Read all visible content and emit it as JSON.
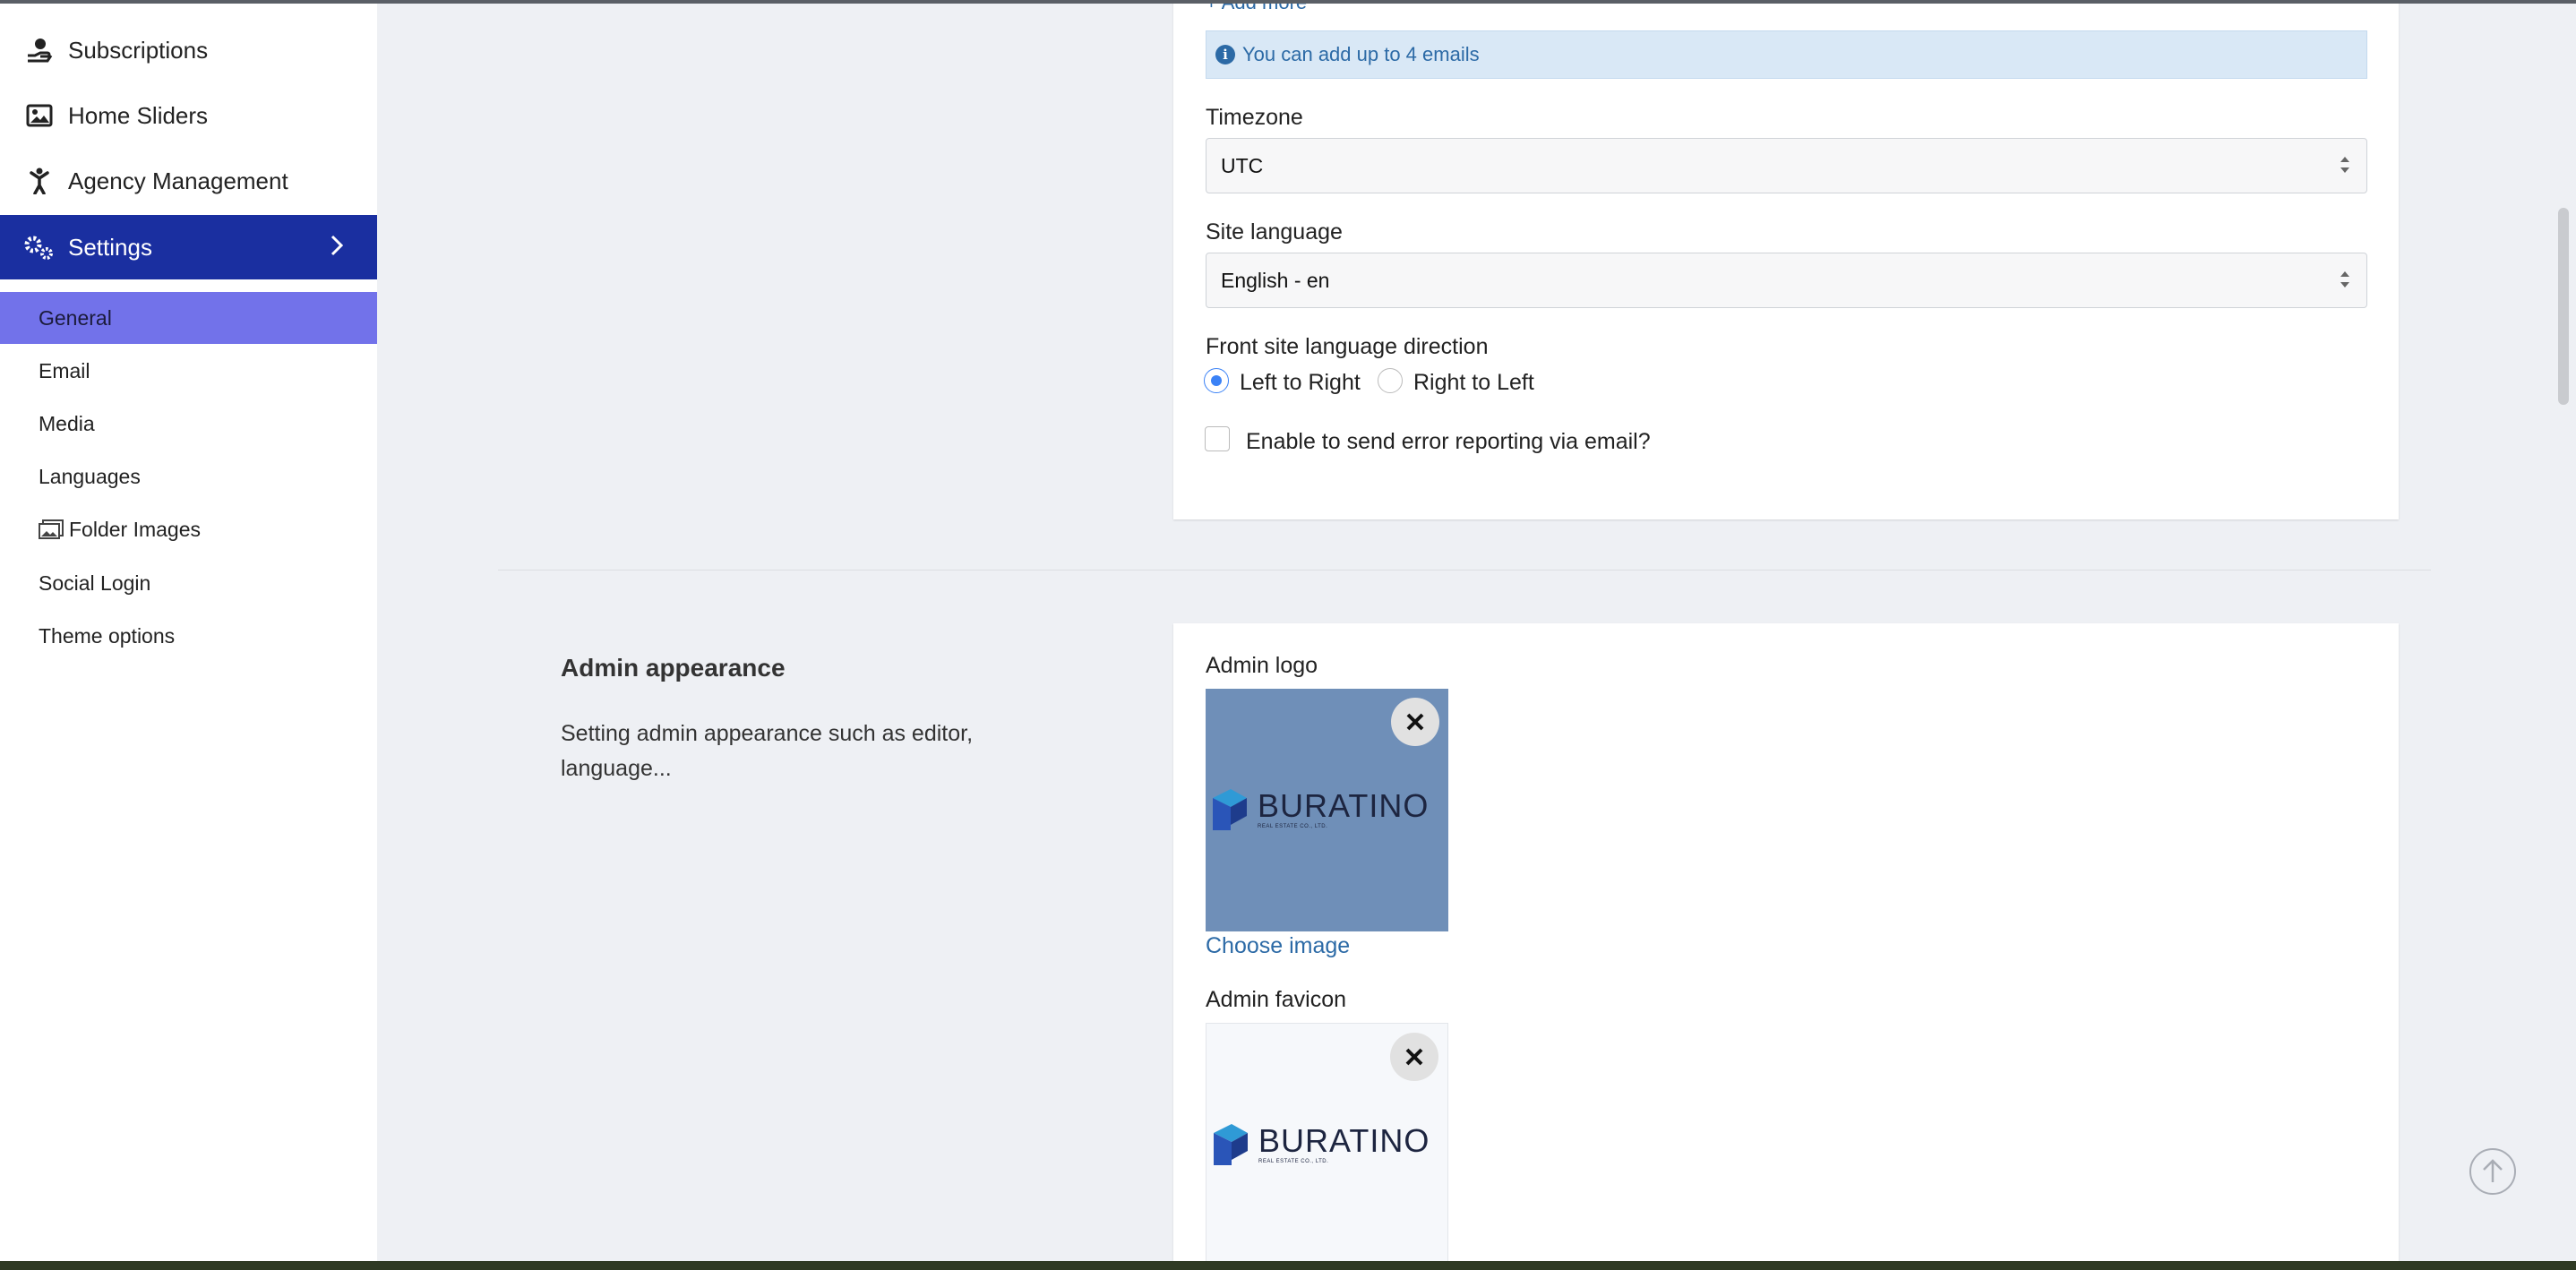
{
  "sidebar": {
    "items": [
      {
        "label": "Subscriptions",
        "icon": "hand-dollar-icon"
      },
      {
        "label": "Home Sliders",
        "icon": "image-icon"
      },
      {
        "label": "Agency Management",
        "icon": "person-arms-up-icon"
      },
      {
        "label": "Settings",
        "icon": "gears-icon"
      }
    ],
    "sub_items": [
      {
        "label": "General"
      },
      {
        "label": "Email"
      },
      {
        "label": "Media"
      },
      {
        "label": "Languages"
      },
      {
        "label": "Folder Images",
        "icon": "images-icon"
      },
      {
        "label": "Social Login"
      },
      {
        "label": "Theme options"
      }
    ],
    "active_color": "#1a2fa0",
    "active_sub_color": "#7272ea"
  },
  "general": {
    "add_more_link": "+ Add more",
    "email_info": "You can add up to 4 emails",
    "timezone": {
      "label": "Timezone",
      "value": "UTC"
    },
    "site_language": {
      "label": "Site language",
      "value": "English - en"
    },
    "direction": {
      "label": "Front site language direction",
      "options": [
        "Left to Right",
        "Right to Left"
      ],
      "selected": "Left to Right"
    },
    "error_reporting": {
      "label": "Enable to send error reporting via email?",
      "checked": false
    }
  },
  "admin_appearance": {
    "title": "Admin appearance",
    "description": "Setting admin appearance such as editor, language...",
    "logo_label": "Admin logo",
    "choose_image": "Choose image",
    "favicon_label": "Admin favicon",
    "brand_word": "BURATINO",
    "brand_tagline": "REAL ESTATE CO., LTD.",
    "logo_bg": "#6f8fb8",
    "favicon_bg": "#f6f8fb"
  },
  "accent_color": "#2c6aa6"
}
